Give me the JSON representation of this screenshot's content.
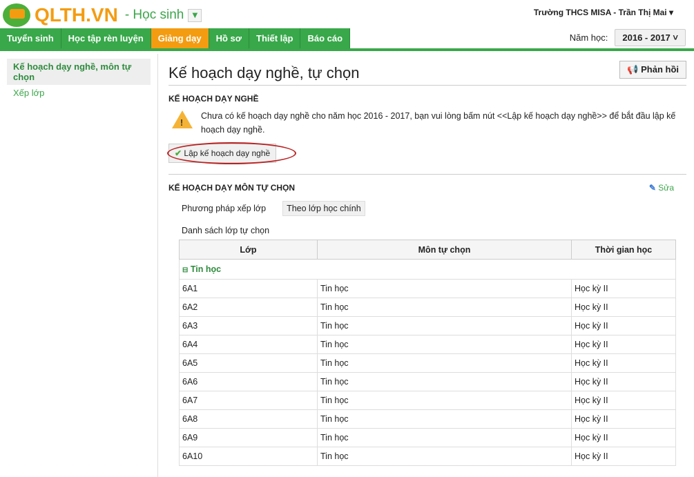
{
  "header": {
    "logo": "QLTH.VN",
    "role": "- Học sinh",
    "user": "Trường THCS MISA - Trần Thị Mai ▾"
  },
  "nav": {
    "tabs": [
      "Tuyển sinh",
      "Học tập rèn luyện",
      "Giảng dạy",
      "Hồ sơ",
      "Thiết lập",
      "Báo cáo"
    ],
    "active": "Giảng dạy",
    "year_label": "Năm học:",
    "year_value": "2016 - 2017 ˅"
  },
  "sidebar": {
    "items": [
      "Kế hoạch dạy nghề, môn tự chọn",
      "Xếp lớp"
    ]
  },
  "main": {
    "title": "Kế hoạch dạy nghề, tự chọn",
    "feedback": "Phản hồi",
    "sec1": "KẾ HOẠCH DẠY NGHỀ",
    "warning": "Chưa có kế hoạch dạy nghề cho năm học 2016 - 2017, bạn vui lòng bấm nút <<Lập kế hoạch dạy nghề>> để bắt đầu lập kế hoạch dạy nghề.",
    "plan_button": "Lập kế hoạch dạy nghề",
    "sec2": "KẾ HOẠCH DẠY MÔN TỰ CHỌN",
    "edit": "Sửa",
    "method_label": "Phương pháp xếp lớp",
    "method_value": "Theo lớp học chính",
    "list_label": "Danh sách lớp tự chọn",
    "columns": [
      "Lớp",
      "Môn tự chọn",
      "Thời gian học"
    ],
    "group": "Tin học",
    "rows": [
      [
        "6A1",
        "Tin học",
        "Học kỳ II"
      ],
      [
        "6A2",
        "Tin học",
        "Học kỳ II"
      ],
      [
        "6A3",
        "Tin học",
        "Học kỳ II"
      ],
      [
        "6A4",
        "Tin học",
        "Học kỳ II"
      ],
      [
        "6A5",
        "Tin học",
        "Học kỳ II"
      ],
      [
        "6A6",
        "Tin học",
        "Học kỳ II"
      ],
      [
        "6A7",
        "Tin học",
        "Học kỳ II"
      ],
      [
        "6A8",
        "Tin học",
        "Học kỳ II"
      ],
      [
        "6A9",
        "Tin học",
        "Học kỳ II"
      ],
      [
        "6A10",
        "Tin học",
        "Học kỳ II"
      ]
    ]
  }
}
